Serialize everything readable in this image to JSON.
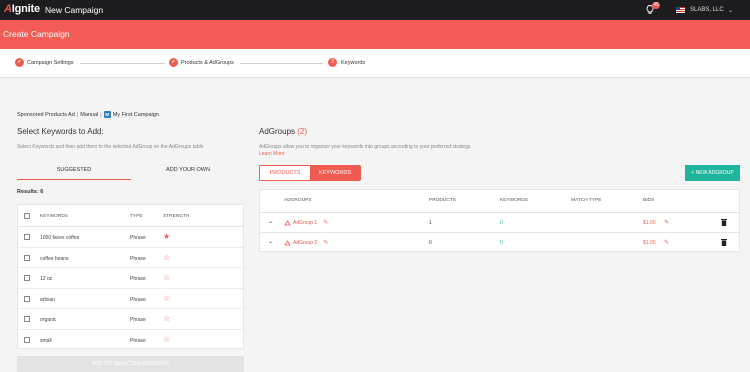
{
  "topbar": {
    "logo_lead": "A",
    "logo_rest": "Ignite",
    "title": "New Campaign",
    "notification_count": "45",
    "company": "SLABS, LLC",
    "company_caret": "⌄"
  },
  "header": {
    "title": "Create Campaign"
  },
  "stepper": {
    "steps": [
      {
        "label": "Campaign Settings",
        "marker": "✔"
      },
      {
        "label": "Products & AdGroups",
        "marker": "✔"
      },
      {
        "label": "Keywords",
        "marker": "3"
      }
    ]
  },
  "breadcrumb": {
    "type": "Sponsored Products Ad",
    "separator": "|",
    "mode": "Manual",
    "badge": "M",
    "campaign": "My First Campaign"
  },
  "select_keywords": {
    "title": "Select Keywords to Add:",
    "subtitle": "Select Keywords and then add them to the selected AdGroup on the AdGroups table",
    "tabs": [
      "SUGGESTED",
      "ADD YOUR OWN"
    ],
    "results_label": "Results: 6",
    "columns": [
      "KEYWORDS",
      "TYPE",
      "STRENGTH"
    ],
    "rows": [
      {
        "keyword": "1000 faces coffee",
        "type": "Phrase",
        "strength": "★"
      },
      {
        "keyword": "coffee beans",
        "type": "Phrase",
        "strength": "☆"
      },
      {
        "keyword": "12 oz",
        "type": "Phrase",
        "strength": "☆"
      },
      {
        "keyword": "artisan",
        "type": "Phrase",
        "strength": "☆"
      },
      {
        "keyword": "organic",
        "type": "Phrase",
        "strength": "☆"
      },
      {
        "keyword": "small",
        "type": "Phrase",
        "strength": "☆"
      }
    ],
    "add_button": "ADD TO SELECTED ADGROUP"
  },
  "adgroups": {
    "title": "AdGroups",
    "count": "(2)",
    "description": "AdGroups allow you to organize your keywords into groups according to your preferred strategy.",
    "learn_more": "Learn More",
    "toggle": [
      "PRODUCTS",
      "KEYWORDS"
    ],
    "new_button": "+ NEW ADGROUP",
    "columns": [
      "ADGROUPS",
      "PRODUCTS",
      "KEYWORDS",
      "MATCH TYPE",
      "BIDS"
    ],
    "rows": [
      {
        "name": "AdGroup 1",
        "products": "1",
        "keywords": "0",
        "match_type": "",
        "bid": "$1.00"
      },
      {
        "name": "AdGroup 2",
        "products": "0",
        "keywords": "0",
        "match_type": "",
        "bid": "$1.00"
      }
    ]
  },
  "colors": {
    "accent": "#f25c54",
    "teal": "#1fb59c",
    "topbar": "#1d1d1f"
  },
  "icons": [
    "lightbulb-icon",
    "us-flag-icon",
    "check-icon",
    "star-icon",
    "chevron-down-icon",
    "pencil-icon",
    "trash-icon",
    "adgroup-icon"
  ]
}
